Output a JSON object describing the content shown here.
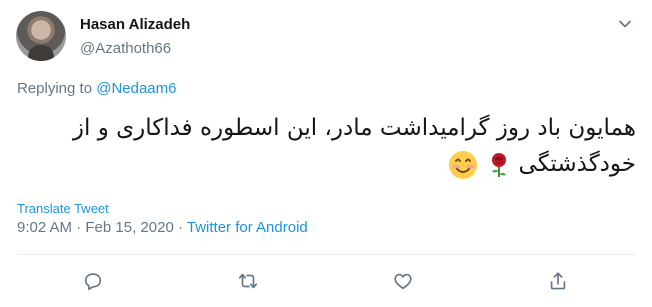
{
  "author": {
    "name": "Hasan Alizadeh",
    "handle": "@Azathoth66"
  },
  "reply": {
    "prefix": "Replying to ",
    "mention": "@Nedaam6"
  },
  "tweet": {
    "text": "همایون باد روز گرامیداشت مادر، این اسطوره فداکاری و از خودگذشتگی",
    "emojis": [
      "rose-emoji",
      "smiling-face-emoji"
    ]
  },
  "translate_label": "Translate Tweet",
  "meta": {
    "time": "9:02 AM",
    "separator1": " · ",
    "date": "Feb 15, 2020",
    "separator2": " · ",
    "source": "Twitter for Android"
  },
  "actions": [
    "reply-icon",
    "retweet-icon",
    "like-icon",
    "share-icon"
  ],
  "colors": {
    "link": "#1b95e0",
    "muted": "#657786",
    "text": "#14171a",
    "divider": "#e6ecf0"
  }
}
